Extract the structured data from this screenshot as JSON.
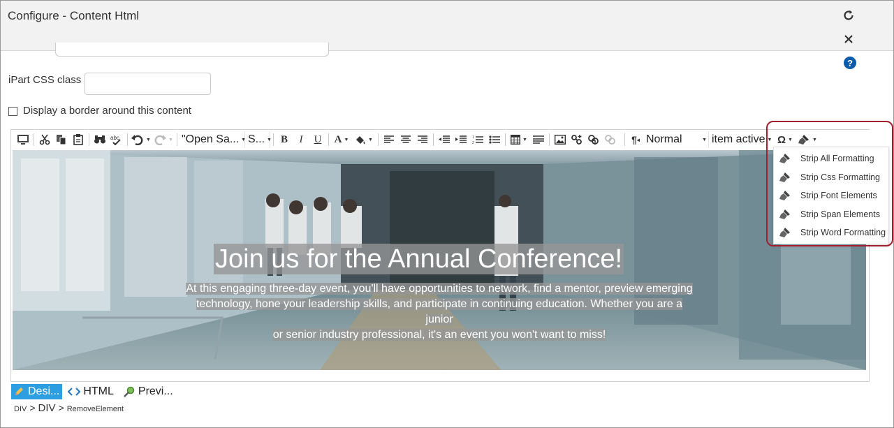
{
  "window": {
    "title": "Configure - Content Html",
    "refresh_icon": "refresh-icon",
    "close_icon": "close-icon",
    "help_icon": "help-icon",
    "help_label": "?"
  },
  "form": {
    "css_class_label": "iPart CSS class",
    "css_class_value": "",
    "border_label": "Display a border around this content",
    "border_checked": false
  },
  "toolbar": {
    "font_family": "\"Open Sa...",
    "font_size": "S...",
    "paragraph_format": "Normal",
    "css_class": "item active"
  },
  "strip_menu": {
    "items": [
      {
        "label": "Strip All Formatting",
        "icon": "brush-icon"
      },
      {
        "label": "Strip Css Formatting",
        "icon": "brush-icon"
      },
      {
        "label": "Strip Font Elements",
        "icon": "brush-icon"
      },
      {
        "label": "Strip Span Elements",
        "icon": "brush-icon"
      },
      {
        "label": "Strip Word Formatting",
        "icon": "brush-icon"
      }
    ]
  },
  "content": {
    "heading": "Join us for the Annual Conference!",
    "line1": "At this engaging three-day event, you'll have opportunities to network, find a mentor, preview emerging",
    "line2": "technology, hone your leadership skills, and participate in continuing education. Whether you are a junior",
    "line3": "or senior industry professional, it's an event you won't want to miss!"
  },
  "modes": {
    "design": "Desi...",
    "html": "HTML",
    "preview": "Previ...",
    "active": "design"
  },
  "breadcrumb": {
    "items": [
      "DIV",
      "DIV",
      "RemoveElement"
    ],
    "separator": ">"
  },
  "colors": {
    "accent": "#2d9ee0",
    "highlight_border": "#a0202f",
    "help_blue": "#0b5cab"
  }
}
